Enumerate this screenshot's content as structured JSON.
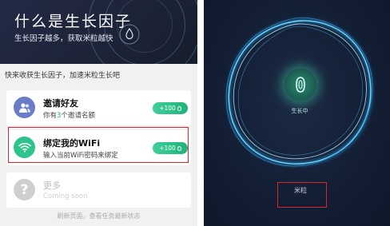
{
  "header": {
    "title": "什么是生长因子",
    "subtitle": "生长因子越多，获取米粒越快"
  },
  "section_tip": "快来收获生长因子，加速米粒生长吧",
  "cards": [
    {
      "title": "邀请好友",
      "desc_prefix": "你有",
      "desc_count": "3",
      "desc_suffix": "个邀请名额",
      "reward": "+100"
    },
    {
      "title": "绑定我的WiFi",
      "desc": "输入当前WiFi密码来绑定",
      "reward": "+100"
    },
    {
      "title": "更多",
      "desc": "Coming soon"
    }
  ],
  "footer_tip": "刷新页面，查看任务最新状态",
  "right": {
    "status": "生长中",
    "mili": "米粒"
  },
  "colors": {
    "accent_green": "#1fb27a",
    "highlight_red": "#d9262c",
    "header_bg": "#1d2438"
  }
}
